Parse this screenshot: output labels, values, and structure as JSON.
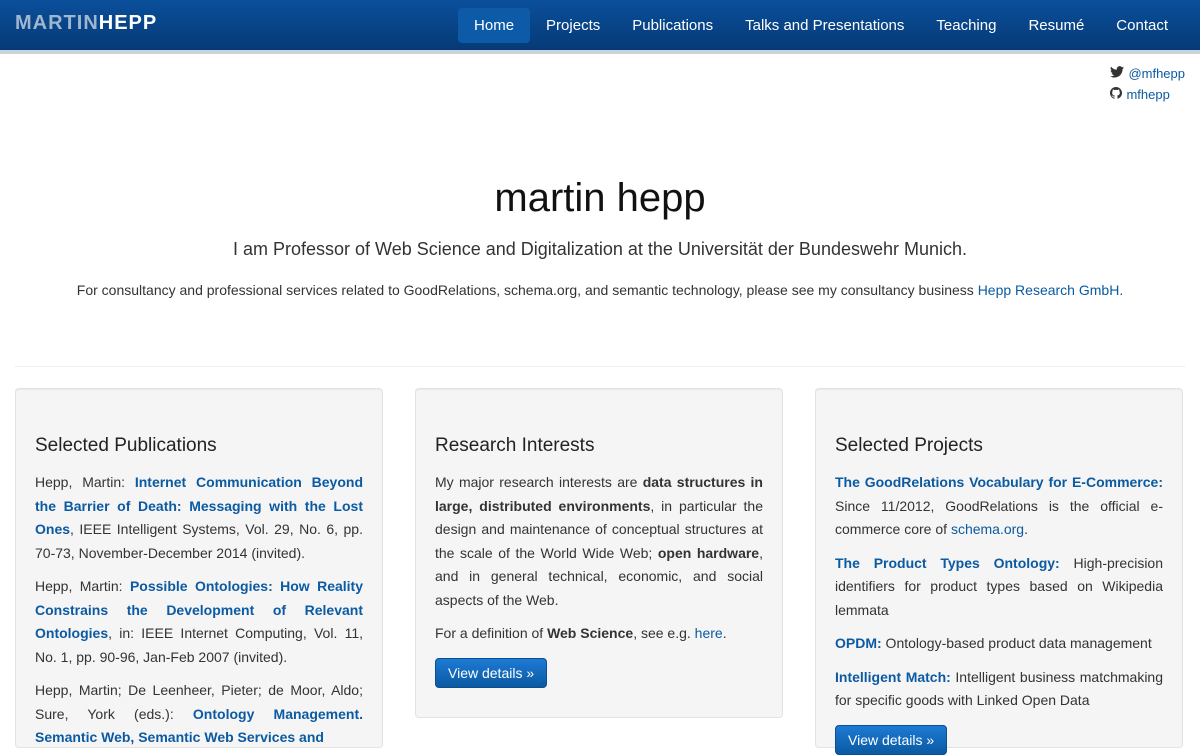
{
  "brand": {
    "first": "MARTIN",
    "last": "HEPP"
  },
  "nav": [
    {
      "label": "Home",
      "active": true
    },
    {
      "label": "Projects"
    },
    {
      "label": "Publications"
    },
    {
      "label": "Talks and Presentations"
    },
    {
      "label": "Teaching"
    },
    {
      "label": "Resumé"
    },
    {
      "label": "Contact"
    }
  ],
  "social": {
    "twitter": "@mfhepp",
    "github": "mfhepp"
  },
  "hero": {
    "title": "martin hepp",
    "lead": "I am Professor of Web Science and Digitalization at the Universität der Bundeswehr Munich.",
    "consult_text": "For consultancy and professional services related to GoodRelations, schema.org, and semantic technology, please see my consultancy business ",
    "consult_link": "Hepp Research GmbH",
    "consult_end": "."
  },
  "publications": {
    "heading": "Selected Publications",
    "items": [
      {
        "authors": "Hepp, Martin: ",
        "title": "Internet Communication Beyond the Barrier of Death: Messaging with the Lost Ones",
        "details": ", IEEE Intelligent Systems, Vol. 29, No. 6, pp. 70-73, November-December 2014 (invited)."
      },
      {
        "authors": "Hepp, Martin: ",
        "title": "Possible Ontologies: How Reality Constrains the Development of Relevant Ontologies",
        "details": ", in: IEEE Internet Computing, Vol. 11, No. 1, pp. 90-96, Jan-Feb 2007 (invited)."
      },
      {
        "authors": "Hepp, Martin; De Leenheer, Pieter; de Moor, Aldo; Sure, York (eds.): ",
        "title": "Ontology Management. Semantic Web, Semantic Web Services and",
        "details": ""
      }
    ]
  },
  "research": {
    "heading": "Research Interests",
    "p1_a": "My major research interests are ",
    "p1_b": "data structures in large, distributed environments",
    "p1_c": ", in particular the design and maintenance of conceptual structures at the scale of the World Wide Web; ",
    "p1_d": "open hardware",
    "p1_e": ", and in general technical, economic, and social aspects of the Web.",
    "p2_a": "For a definition of ",
    "p2_b": "Web Science",
    "p2_c": ", see e.g. ",
    "p2_link": "here",
    "p2_end": ".",
    "button": "View details »"
  },
  "projects": {
    "heading": "Selected Projects",
    "items": [
      {
        "name": "The GoodRelations Vocabulary for E-Commerce:",
        "text": " Since 11/2012, GoodRelations is the official e-commerce core of ",
        "link": "schema.org",
        "end": "."
      },
      {
        "name": "The Product Types Ontology:",
        "text": " High-precision identifiers for product types based on Wikipedia lemmata",
        "link": "",
        "end": ""
      },
      {
        "name": "OPDM:",
        "text": " Ontology-based product data management",
        "link": "",
        "end": ""
      },
      {
        "name": "Intelligent Match:",
        "text": " Intelligent business matchmaking for specific goods with Linked Open Data",
        "link": "",
        "end": ""
      }
    ],
    "button": "View details »"
  }
}
